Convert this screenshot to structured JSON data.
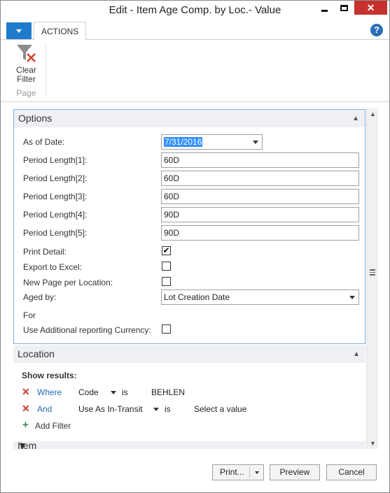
{
  "window": {
    "title": "Edit - Item Age Comp. by Loc.- Value",
    "minimize": "—",
    "close": "✕"
  },
  "ribbon": {
    "tab_actions": "ACTIONS",
    "help": "?",
    "clear_filter_label": "Clear Filter",
    "group_label": "Page"
  },
  "options": {
    "header": "Options",
    "as_of_date_label": "As of Date:",
    "as_of_date_value": "7/31/2016",
    "period_lengths": [
      {
        "label": "Period Length[1]:",
        "value": "60D"
      },
      {
        "label": "Period Length[2]:",
        "value": "60D"
      },
      {
        "label": "Period Length[3]:",
        "value": "60D"
      },
      {
        "label": "Period Length[4]:",
        "value": "90D"
      },
      {
        "label": "Period Length[5]:",
        "value": "90D"
      }
    ],
    "print_detail_label": "Print Detail:",
    "print_detail_checked": true,
    "export_excel_label": "Export to Excel:",
    "export_excel_checked": false,
    "new_page_label": "New Page per Location:",
    "new_page_checked": false,
    "aged_by_label": "Aged by:",
    "aged_by_value": "Lot Creation Date",
    "for_label": "For",
    "additional_currency_label": "Use Additional reporting Currency:",
    "additional_currency_checked": false
  },
  "location": {
    "header": "Location",
    "show_results": "Show results:",
    "filters": [
      {
        "conj": "Where",
        "field": "Code",
        "op": "is",
        "value": "BEHLEN"
      },
      {
        "conj": "And",
        "field": "Use As In-Transit",
        "op": "is",
        "value": "Select a value"
      }
    ],
    "add_filter": "Add Filter"
  },
  "item": {
    "header": "Item"
  },
  "buttons": {
    "print": "Print...",
    "preview": "Preview",
    "cancel": "Cancel"
  },
  "colors": {
    "accent": "#1f7ccd",
    "close_button": "#c7312d",
    "filter_remove": "#d43c2a",
    "add_filter": "#2f8f4e",
    "selection": "#3390ff"
  }
}
